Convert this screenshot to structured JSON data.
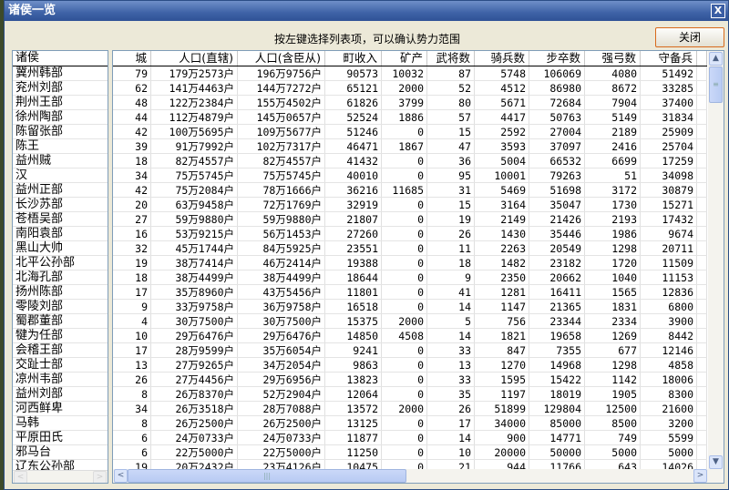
{
  "window": {
    "title": "诸侯一览",
    "close_x": "X"
  },
  "hint": "按左键选择列表项，可以确认势力范围",
  "close_button": "关闭",
  "left_header": "诸侯",
  "columns": [
    "城",
    "人口(直辖)",
    "人口(含臣从)",
    "町收入",
    "矿产",
    "武将数",
    "骑兵数",
    "步卒数",
    "强弓数",
    "守备兵"
  ],
  "rows": [
    [
      "冀州韩部",
      "79",
      "179万2573户",
      "196万9756户",
      "90573",
      "10032",
      "87",
      "5748",
      "106069",
      "4080",
      "51492"
    ],
    [
      "兖州刘部",
      "62",
      "141万4463户",
      "144万7272户",
      "65121",
      "2000",
      "52",
      "4512",
      "86980",
      "8672",
      "33285"
    ],
    [
      "荆州王部",
      "48",
      "122万2384户",
      "155万4502户",
      "61826",
      "3799",
      "80",
      "5671",
      "72684",
      "7904",
      "37400"
    ],
    [
      "徐州陶部",
      "44",
      "112万4879户",
      "145万0657户",
      "52524",
      "1886",
      "57",
      "4417",
      "50763",
      "5149",
      "31834"
    ],
    [
      "陈留张部",
      "42",
      "100万5695户",
      "109万5677户",
      "51246",
      "0",
      "15",
      "2592",
      "27004",
      "2189",
      "25909"
    ],
    [
      "陈王",
      "39",
      "91万7992户",
      "102万7317户",
      "46471",
      "1867",
      "47",
      "3593",
      "37097",
      "2416",
      "25704"
    ],
    [
      "益州贼",
      "18",
      "82万4557户",
      "82万4557户",
      "41432",
      "0",
      "36",
      "5004",
      "66532",
      "6699",
      "17259"
    ],
    [
      "汉",
      "34",
      "75万5745户",
      "75万5745户",
      "40010",
      "0",
      "95",
      "10001",
      "79263",
      "51",
      "34098"
    ],
    [
      "益州正部",
      "42",
      "75万2084户",
      "78万1666户",
      "36216",
      "11685",
      "31",
      "5469",
      "51698",
      "3172",
      "30879"
    ],
    [
      "长沙苏部",
      "20",
      "63万9458户",
      "72万1769户",
      "32919",
      "0",
      "15",
      "3164",
      "35047",
      "1730",
      "15271"
    ],
    [
      "苍梧吴部",
      "27",
      "59万9880户",
      "59万9880户",
      "21807",
      "0",
      "19",
      "2149",
      "21426",
      "2193",
      "17432"
    ],
    [
      "南阳袁部",
      "16",
      "53万9215户",
      "56万1453户",
      "27260",
      "0",
      "26",
      "1430",
      "35446",
      "1986",
      "9674"
    ],
    [
      "黑山大帅",
      "32",
      "45万1744户",
      "84万5925户",
      "23551",
      "0",
      "11",
      "2263",
      "20549",
      "1298",
      "20711"
    ],
    [
      "北平公孙部",
      "19",
      "38万7414户",
      "46万2414户",
      "19388",
      "0",
      "18",
      "1482",
      "23182",
      "1720",
      "11509"
    ],
    [
      "北海孔部",
      "18",
      "38万4499户",
      "38万4499户",
      "18644",
      "0",
      "9",
      "2350",
      "20662",
      "1040",
      "11153"
    ],
    [
      "扬州陈部",
      "17",
      "35万8960户",
      "43万5456户",
      "11801",
      "0",
      "41",
      "1281",
      "16411",
      "1565",
      "12836"
    ],
    [
      "零陵刘部",
      "9",
      "33万9758户",
      "36万9758户",
      "16518",
      "0",
      "14",
      "1147",
      "21365",
      "1831",
      "6800"
    ],
    [
      "蜀郡董部",
      "4",
      "30万7500户",
      "30万7500户",
      "15375",
      "2000",
      "5",
      "756",
      "23344",
      "2334",
      "3900"
    ],
    [
      "犍为任部",
      "10",
      "29万6476户",
      "29万6476户",
      "14850",
      "4508",
      "14",
      "1821",
      "19658",
      "1269",
      "8442"
    ],
    [
      "会稽王部",
      "17",
      "28万9599户",
      "35万6054户",
      "9241",
      "0",
      "33",
      "847",
      "7355",
      "677",
      "12146"
    ],
    [
      "交趾士部",
      "13",
      "27万9265户",
      "34万2054户",
      "9863",
      "0",
      "13",
      "1270",
      "14968",
      "1298",
      "4858"
    ],
    [
      "凉州韦部",
      "26",
      "27万4456户",
      "29万6956户",
      "13823",
      "0",
      "33",
      "1595",
      "15422",
      "1142",
      "18006"
    ],
    [
      "益州刘部",
      "8",
      "26万8370户",
      "52万2904户",
      "12064",
      "0",
      "35",
      "1197",
      "18019",
      "1905",
      "8300"
    ],
    [
      "河西鲜卑",
      "34",
      "26万3518户",
      "28万7088户",
      "13572",
      "2000",
      "26",
      "51899",
      "129804",
      "12500",
      "21600"
    ],
    [
      "马韩",
      "8",
      "26万2500户",
      "26万2500户",
      "13125",
      "0",
      "17",
      "34000",
      "85000",
      "8500",
      "3200"
    ],
    [
      "平原田氏",
      "6",
      "24万0733户",
      "24万0733户",
      "11877",
      "0",
      "14",
      "900",
      "14771",
      "749",
      "5599"
    ],
    [
      "邪马台",
      "6",
      "22万5000户",
      "22万5000户",
      "11250",
      "0",
      "10",
      "20000",
      "50000",
      "5000",
      "5000"
    ],
    [
      "辽东公孙部",
      "19",
      "20万2432户",
      "23万4126户",
      "10475",
      "0",
      "21",
      "944",
      "11766",
      "643",
      "14026"
    ]
  ]
}
